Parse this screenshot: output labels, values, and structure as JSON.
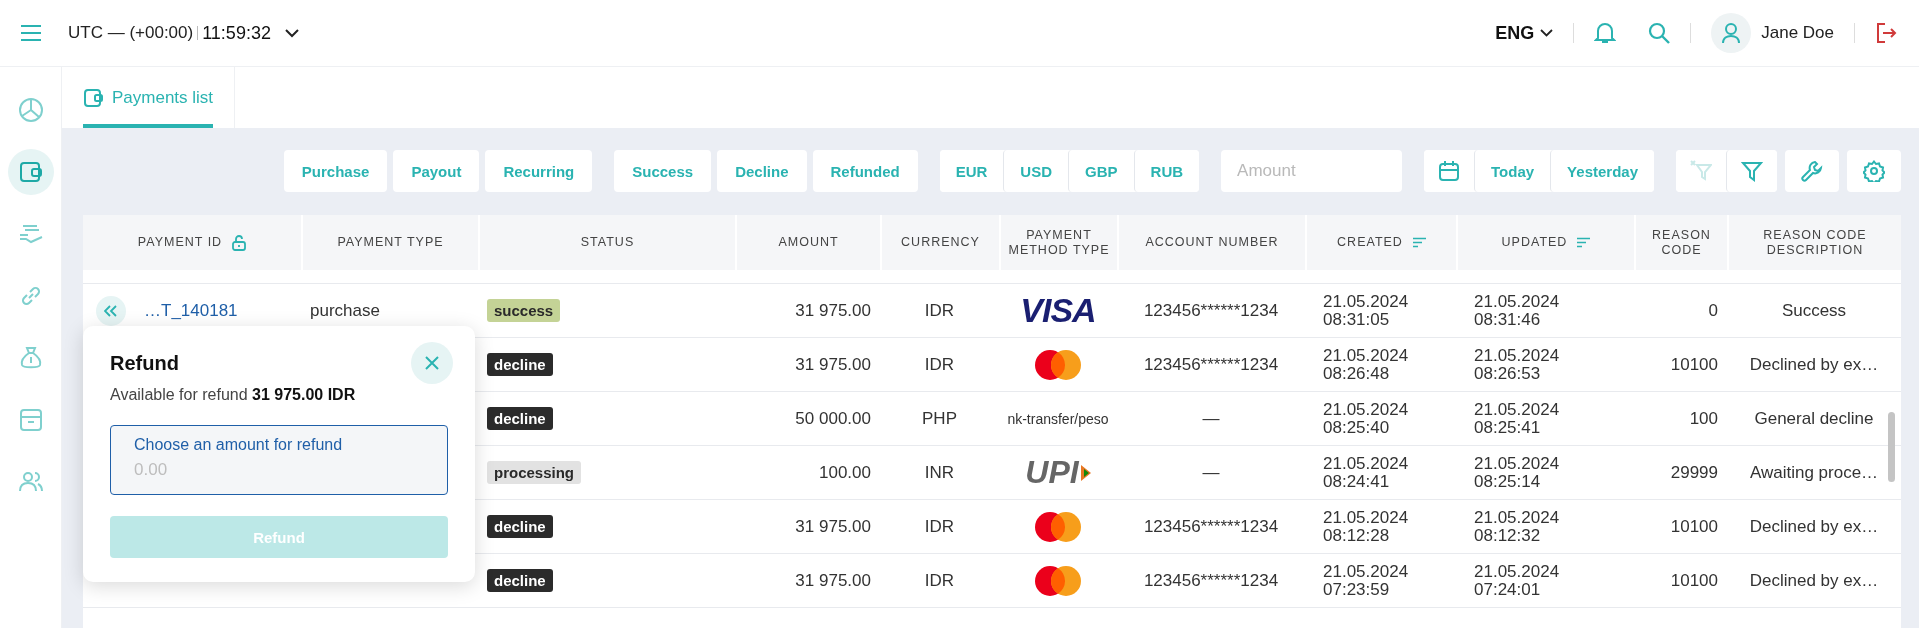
{
  "topbar": {
    "timezone": "UTC — (+00:00)",
    "time": "11:59:32",
    "language": "ENG",
    "user": "Jane Doe"
  },
  "sidebar": {
    "items": [
      {
        "kind": "chart",
        "selected": false
      },
      {
        "kind": "wallet",
        "selected": true
      },
      {
        "kind": "hand",
        "selected": false
      },
      {
        "kind": "link",
        "selected": false
      },
      {
        "kind": "bag",
        "selected": false
      },
      {
        "kind": "archive",
        "selected": false
      },
      {
        "kind": "users",
        "selected": false
      }
    ]
  },
  "tabs": [
    {
      "label": "Payments list",
      "selected": true
    }
  ],
  "filters": {
    "type_buttons": [
      "Purchase",
      "Payout",
      "Recurring"
    ],
    "status_buttons": [
      "Success",
      "Decline",
      "Refunded"
    ],
    "currency_buttons": [
      "EUR",
      "USD",
      "GBP",
      "RUB"
    ],
    "amount": {
      "placeholder": "Amount"
    },
    "date_buttons": [
      "Today",
      "Yesterday"
    ]
  },
  "table": {
    "columns": [
      {
        "label": "PAYMENT ID",
        "kind": "lockable"
      },
      {
        "label": "PAYMENT TYPE",
        "kind": "plain"
      },
      {
        "label": "STATUS",
        "kind": "plain"
      },
      {
        "label": "AMOUNT",
        "kind": "plain"
      },
      {
        "label": "CURRENCY",
        "kind": "plain"
      },
      {
        "label": "PAYMENT METHOD TYPE",
        "kind": "plain"
      },
      {
        "label": "ACCOUNT NUMBER",
        "kind": "plain"
      },
      {
        "label": "CREATED",
        "kind": "sortable"
      },
      {
        "label": "UPDATED",
        "kind": "sortable"
      },
      {
        "label": "REASON CODE",
        "kind": "plain"
      },
      {
        "label": "REASON CODE DESCRIPTION",
        "kind": "plain"
      }
    ],
    "rows": [
      {
        "action_button": true,
        "payment_id": "…T_140181",
        "payment_type": "purchase",
        "status": {
          "label": "success",
          "kind": "success"
        },
        "amount": "31 975.00",
        "currency": "IDR",
        "method": {
          "kind": "visa",
          "text": "VISA"
        },
        "account": "123456******1234",
        "created_date": "21.05.2024",
        "created_time": "08:31:05",
        "updated_date": "21.05.2024",
        "updated_time": "08:31:46",
        "reason_code": "0",
        "reason_description": "Success"
      },
      {
        "status": {
          "label": "decline",
          "kind": "decline"
        },
        "amount": "31 975.00",
        "currency": "IDR",
        "method": {
          "kind": "mastercard"
        },
        "account": "123456******1234",
        "created_date": "21.05.2024",
        "created_time": "08:26:48",
        "updated_date": "21.05.2024",
        "updated_time": "08:26:53",
        "reason_code": "10100",
        "reason_description": "Declined by ex…"
      },
      {
        "status": {
          "label": "decline",
          "kind": "decline"
        },
        "amount": "50 000.00",
        "currency": "PHP",
        "method": {
          "kind": "text",
          "text": "nk-transfer/peso"
        },
        "account": "—",
        "created_date": "21.05.2024",
        "created_time": "08:25:40",
        "updated_date": "21.05.2024",
        "updated_time": "08:25:41",
        "reason_code": "100",
        "reason_description": "General decline"
      },
      {
        "status": {
          "label": "processing",
          "kind": "processing"
        },
        "amount": "100.00",
        "currency": "INR",
        "method": {
          "kind": "upi",
          "text": "UPI"
        },
        "account": "—",
        "created_date": "21.05.2024",
        "created_time": "08:24:41",
        "updated_date": "21.05.2024",
        "updated_time": "08:25:14",
        "reason_code": "29999",
        "reason_description": "Awaiting proce…"
      },
      {
        "status": {
          "label": "decline",
          "kind": "decline"
        },
        "amount": "31 975.00",
        "currency": "IDR",
        "method": {
          "kind": "mastercard"
        },
        "account": "123456******1234",
        "created_date": "21.05.2024",
        "created_time": "08:12:28",
        "updated_date": "21.05.2024",
        "updated_time": "08:12:32",
        "reason_code": "10100",
        "reason_description": "Declined by ex…"
      },
      {
        "status": {
          "label": "decline",
          "kind": "decline"
        },
        "amount": "31 975.00",
        "currency": "IDR",
        "method": {
          "kind": "mastercard"
        },
        "account": "123456******1234",
        "created_date": "21.05.2024",
        "created_time": "07:23:59",
        "updated_date": "21.05.2024",
        "updated_time": "07:24:01",
        "reason_code": "10100",
        "reason_description": "Declined by ex…"
      }
    ]
  },
  "refund_popover": {
    "title": "Refund",
    "available": "Available for refund **31 975.00 IDR**",
    "field": {
      "label": "Choose an amount for refund",
      "placeholder": "0.00"
    },
    "button": {
      "label": "Refund",
      "disabled": true
    }
  }
}
